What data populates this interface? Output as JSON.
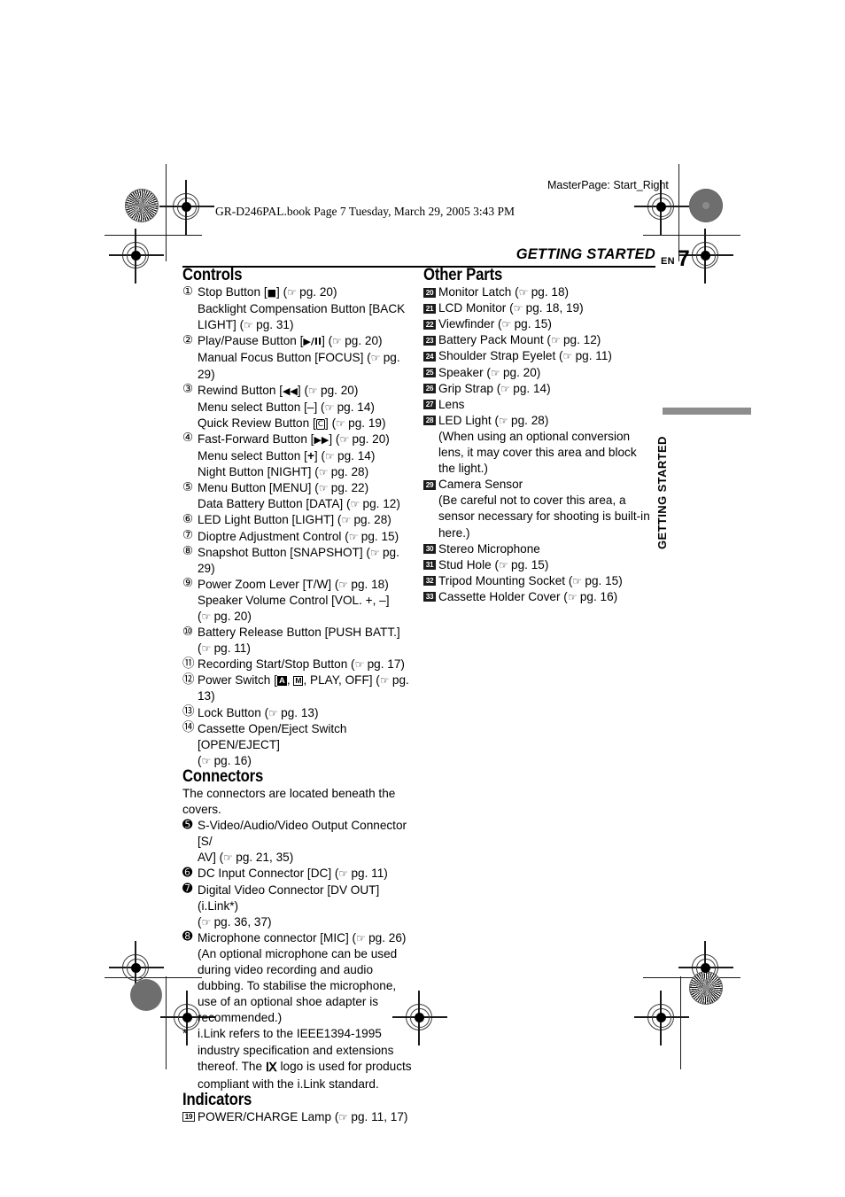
{
  "page": {
    "masterpage": "MasterPage: Start_Right",
    "bookline": "GR-D246PAL.book  Page 7  Tuesday, March 29, 2005  3:43 PM",
    "running_head": "GETTING STARTED",
    "folio_lang": "EN",
    "folio_number": "7",
    "side_tab": "GETTING STARTED",
    "accent_gray": "#8d8d8d",
    "badge_dark": "#1c1c1c"
  },
  "sections": {
    "controls": {
      "title": "Controls",
      "items": [
        {
          "n": "①",
          "style": "circ",
          "lines": [
            "Stop Button [■] (☞ pg. 20)",
            "Backlight Compensation Button [BACK LIGHT] (☞ pg. 31)"
          ]
        },
        {
          "n": "②",
          "style": "circ",
          "lines": [
            "Play/Pause Button [▶/❙❙] (☞ pg. 20)",
            "Manual Focus Button [FOCUS] (☞ pg. 29)"
          ]
        },
        {
          "n": "③",
          "style": "circ",
          "lines": [
            "Rewind Button [◀◀] (☞ pg. 20)",
            "Menu select Button [–] (☞ pg. 14)",
            "Quick Review Button [Ⓒ] (☞ pg. 19)"
          ]
        },
        {
          "n": "④",
          "style": "circ",
          "lines": [
            "Fast-Forward Button [▶▶] (☞ pg. 20)",
            "Menu select Button [+] (☞ pg. 14)",
            "Night Button [NIGHT] (☞ pg. 28)"
          ]
        },
        {
          "n": "⑤",
          "style": "circ",
          "lines": [
            "Menu Button [MENU] (☞ pg. 22)",
            "Data Battery Button [DATA] (☞ pg. 12)"
          ]
        },
        {
          "n": "⑥",
          "style": "circ",
          "lines": [
            "LED Light Button [LIGHT] (☞ pg. 28)"
          ]
        },
        {
          "n": "⑦",
          "style": "circ",
          "lines": [
            "Dioptre Adjustment Control (☞ pg. 15)"
          ]
        },
        {
          "n": "⑧",
          "style": "circ",
          "lines": [
            "Snapshot Button [SNAPSHOT] (☞ pg. 29)"
          ]
        },
        {
          "n": "⑨",
          "style": "circ",
          "lines": [
            "Power Zoom Lever [T/W] (☞ pg. 18)",
            "Speaker Volume Control [VOL. +, –]",
            "(☞ pg. 20)"
          ]
        },
        {
          "n": "⑩",
          "style": "circ",
          "lines": [
            "Battery Release Button [PUSH BATT.]",
            "(☞ pg. 11)"
          ]
        },
        {
          "n": "⑪",
          "style": "circ",
          "lines": [
            "Recording Start/Stop Button (☞ pg. 17)"
          ]
        },
        {
          "n": "⑫",
          "style": "circ",
          "lines": [
            "Power Switch [A, M, PLAY, OFF] (☞ pg. 13)"
          ]
        },
        {
          "n": "⑬",
          "style": "circ",
          "lines": [
            "Lock Button (☞ pg. 13)"
          ]
        },
        {
          "n": "⑭",
          "style": "circ",
          "lines": [
            "Cassette Open/Eject Switch [OPEN/EJECT]",
            "(☞ pg. 16)"
          ]
        }
      ]
    },
    "connectors": {
      "title": "Connectors",
      "intro": "The connectors are located beneath the covers.",
      "items": [
        {
          "n": "➎",
          "style": "filled-circ",
          "lines": [
            "S-Video/Audio/Video Output Connector [S/",
            "AV] (☞ pg. 21, 35)"
          ]
        },
        {
          "n": "➏",
          "style": "filled-circ",
          "lines": [
            "DC Input Connector [DC] (☞ pg. 11)"
          ]
        },
        {
          "n": "➐",
          "style": "filled-circ",
          "lines": [
            "Digital Video Connector [DV OUT] (i.Link*)",
            "(☞ pg. 36, 37)"
          ]
        },
        {
          "n": "➑",
          "style": "filled-circ",
          "lines": [
            "Microphone connector [MIC] (☞ pg. 26)",
            "(An optional microphone can be used during video recording and audio dubbing. To stabilise the microphone, use of an optional shoe adapter is recommended.)"
          ]
        }
      ],
      "footnote": {
        "marker": "*",
        "text_before": "i.Link refers to the IEEE1394-1995 industry specification and extensions thereof. The",
        "logo": "i.Link",
        "text_after": "logo is used for products compliant with the i.Link standard."
      }
    },
    "indicators": {
      "title": "Indicators",
      "items": [
        {
          "n": "19",
          "style": "sq-outline",
          "lines": [
            "POWER/CHARGE Lamp (☞ pg. 11, 17)"
          ]
        }
      ]
    },
    "other_parts": {
      "title": "Other Parts",
      "items": [
        {
          "n": "20",
          "style": "sq",
          "lines": [
            "Monitor Latch (☞ pg. 18)"
          ]
        },
        {
          "n": "21",
          "style": "sq",
          "lines": [
            "LCD Monitor (☞ pg. 18, 19)"
          ]
        },
        {
          "n": "22",
          "style": "sq",
          "lines": [
            "Viewfinder (☞ pg. 15)"
          ]
        },
        {
          "n": "23",
          "style": "sq",
          "lines": [
            "Battery Pack Mount (☞ pg. 12)"
          ]
        },
        {
          "n": "24",
          "style": "sq",
          "lines": [
            "Shoulder Strap Eyelet (☞ pg. 11)"
          ]
        },
        {
          "n": "25",
          "style": "sq",
          "lines": [
            "Speaker (☞ pg. 20)"
          ]
        },
        {
          "n": "26",
          "style": "sq",
          "lines": [
            "Grip Strap (☞ pg. 14)"
          ]
        },
        {
          "n": "27",
          "style": "sq",
          "lines": [
            "Lens"
          ]
        },
        {
          "n": "28",
          "style": "sq",
          "lines": [
            "LED Light (☞ pg. 28)",
            "(When using an optional conversion lens, it may cover this area and block the light.)"
          ]
        },
        {
          "n": "29",
          "style": "sq",
          "lines": [
            "Camera Sensor",
            "(Be careful not to cover this area, a sensor necessary for shooting is built-in here.)"
          ]
        },
        {
          "n": "30",
          "style": "sq",
          "lines": [
            "Stereo Microphone"
          ]
        },
        {
          "n": "31",
          "style": "sq",
          "lines": [
            "Stud Hole (☞ pg. 15)"
          ]
        },
        {
          "n": "32",
          "style": "sq",
          "lines": [
            "Tripod Mounting Socket (☞ pg. 15)"
          ]
        },
        {
          "n": "33",
          "style": "sq",
          "lines": [
            "Cassette Holder Cover (☞ pg. 16)"
          ]
        }
      ]
    }
  }
}
